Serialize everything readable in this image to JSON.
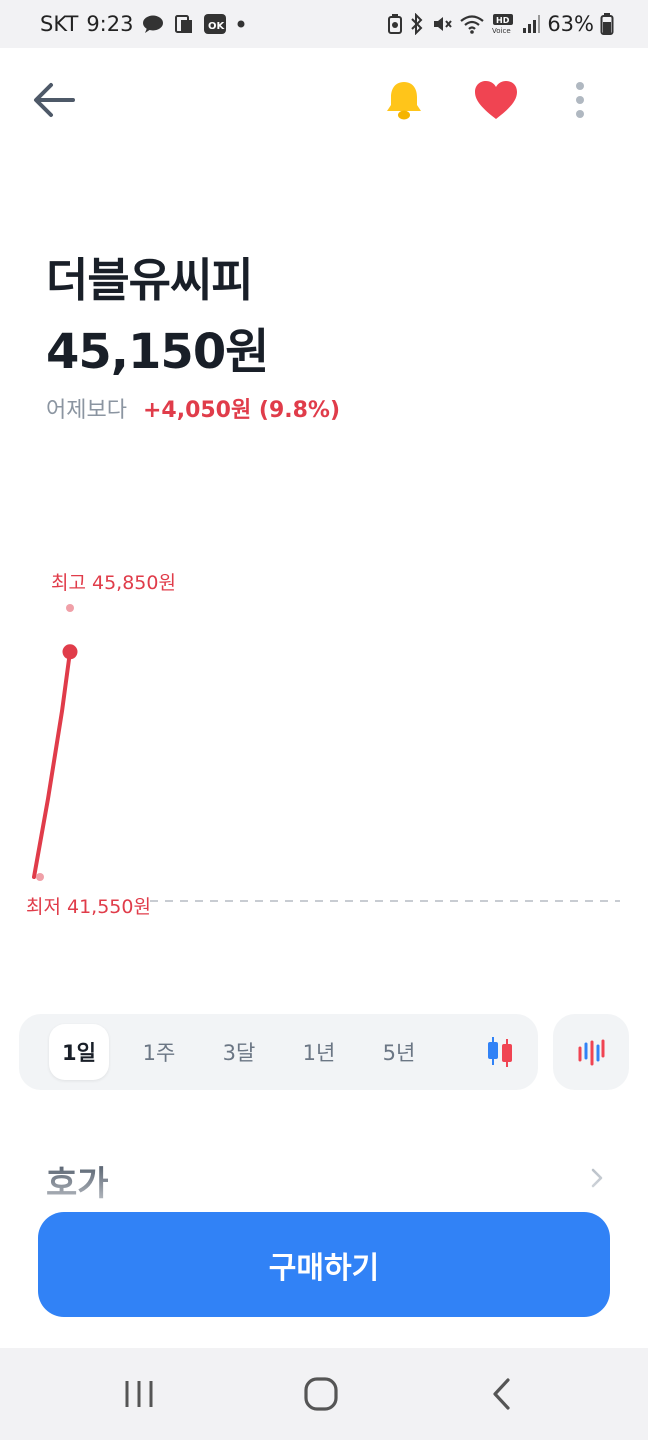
{
  "status_bar": {
    "carrier": "SKT",
    "time": "9:23",
    "battery_percent": "63%",
    "left_icons": [
      "kakaotalk-icon",
      "sim-card-icon",
      "ok-cashbag-icon",
      "notification-dot-icon"
    ],
    "right_icons": [
      "battery-saver-icon",
      "bluetooth-icon",
      "mute-icon",
      "wifi-icon",
      "hd-voice-icon",
      "signal-icon",
      "battery-icon"
    ],
    "hd_voice": "HD Voice"
  },
  "top_nav": {
    "back_icon": "arrow-left-icon",
    "bell_icon": "bell-icon",
    "heart_icon": "heart-icon",
    "more_icon": "more-vertical-icon"
  },
  "stock": {
    "name": "더블유씨피",
    "price": "45,150원",
    "change_label": "어제보다",
    "change_value": "+4,050원 (9.8%)"
  },
  "chart": {
    "high_label": "최고 45,850원",
    "low_label": "최저 41,550원",
    "line_color": "#e03c4a",
    "marker_color": "#f0a0a8"
  },
  "chart_data": {
    "type": "line",
    "series": [
      {
        "values": [
          41550,
          42800,
          44200,
          45150
        ]
      }
    ],
    "high": 45850,
    "low": 41550,
    "ylim": [
      41550,
      45850
    ]
  },
  "period_tabs": [
    {
      "label": "1일",
      "active": true
    },
    {
      "label": "1주",
      "active": false
    },
    {
      "label": "3달",
      "active": false
    },
    {
      "label": "1년",
      "active": false
    },
    {
      "label": "5년",
      "active": false
    }
  ],
  "chart_type_icons": [
    "candlestick-icon",
    "compare-chart-icon"
  ],
  "order_book": {
    "title": "호가",
    "chevron_icon": "chevron-right-icon"
  },
  "buy_button": {
    "label": "구매하기",
    "color": "#3182f6"
  },
  "nav_bar": {
    "icons": [
      "recent-apps-icon",
      "home-icon",
      "back-icon"
    ]
  }
}
